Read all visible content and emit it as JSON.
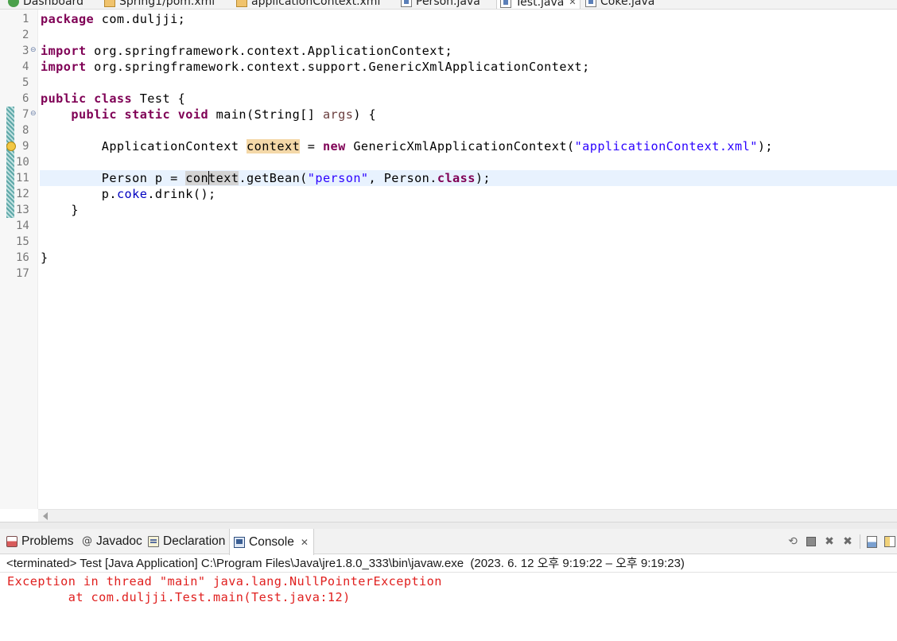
{
  "editor_tabs": [
    {
      "label": "Dashboard",
      "icon": "dashboard-icon",
      "active": false
    },
    {
      "label": "Spring1/pom.xml",
      "icon": "xml-file-icon",
      "active": false
    },
    {
      "label": "applicationContext.xml",
      "icon": "xml-file-icon",
      "active": false
    },
    {
      "label": "Person.java",
      "icon": "java-file-icon",
      "active": false
    },
    {
      "label": "Test.java",
      "icon": "java-file-icon",
      "active": true,
      "close": "✕"
    },
    {
      "label": "Coke.java",
      "icon": "java-file-icon",
      "active": false
    }
  ],
  "editor": {
    "line_numbers": [
      "1",
      "2",
      "3",
      "4",
      "5",
      "6",
      "7",
      "8",
      "9",
      "10",
      "11",
      "12",
      "13",
      "14",
      "15",
      "16",
      "17"
    ],
    "current_line": 11,
    "fold_marker": "⊖",
    "lines": {
      "l1_kw": "package",
      "l1_rest": " com.duljji;",
      "l3_kw": "import",
      "l3_rest": " org.springframework.context.ApplicationContext;",
      "l4_kw": "import",
      "l4_rest": " org.springframework.context.support.GenericXmlApplicationContext;",
      "l6_kw1": "public",
      "l6_kw2": "class",
      "l6_rest": " Test {",
      "l7_indent": "    ",
      "l7_kw1": "public",
      "l7_kw2": "static",
      "l7_kw3": "void",
      "l7_mid": " main(String[] ",
      "l7_param": "args",
      "l7_end": ") {",
      "l9_pre": "        ApplicationContext ",
      "l9_var": "context",
      "l9_eq": " = ",
      "l9_kw": "new",
      "l9_type": " GenericXmlApplicationContext(",
      "l9_str": "\"applicationContext.xml\"",
      "l9_end": ");",
      "l11_pre": "        Person p = ",
      "l11_var_a": "con",
      "l11_var_b": "text",
      "l11_mid": ".getBean(",
      "l11_str": "\"person\"",
      "l11_mid2": ", Person.",
      "l11_kw": "class",
      "l11_end": ");",
      "l12_pre": "        p.",
      "l12_field": "coke",
      "l12_end": ".drink();",
      "l13": "    }",
      "l16": "}"
    }
  },
  "bottom_view": {
    "tabs": [
      {
        "label": "Problems",
        "icon": "problems-icon"
      },
      {
        "label": "Javadoc",
        "icon": "javadoc-icon",
        "glyph": "@"
      },
      {
        "label": "Declaration",
        "icon": "declaration-icon"
      },
      {
        "label": "Console",
        "icon": "console-icon",
        "active": true,
        "close": "✕"
      }
    ],
    "toolbar": [
      {
        "name": "terminate-relaunch-icon",
        "glyph": "⟲"
      },
      {
        "name": "terminate-icon",
        "glyph": ""
      },
      {
        "name": "remove-launch-icon",
        "glyph": "✖"
      },
      {
        "name": "remove-all-terminated-icon",
        "glyph": "✖"
      },
      {
        "name": "scroll-lock-icon",
        "glyph": ""
      },
      {
        "name": "word-wrap-icon",
        "glyph": ""
      }
    ],
    "console_header": "<terminated> Test [Java Application] C:\\Program Files\\Java\\jre1.8.0_333\\bin\\javaw.exe  (2023. 6. 12 오후 9:19:22 – 오후 9:19:23)",
    "console_output": [
      "Exception in thread \"main\" java.lang.NullPointerException",
      "        at com.duljji.Test.main(Test.java:12)"
    ]
  },
  "colors": {
    "keyword": "#7f0055",
    "string": "#2a00ff",
    "field": "#0000c0",
    "error_text": "#e0201f",
    "current_line_bg": "#e8f2fe"
  }
}
